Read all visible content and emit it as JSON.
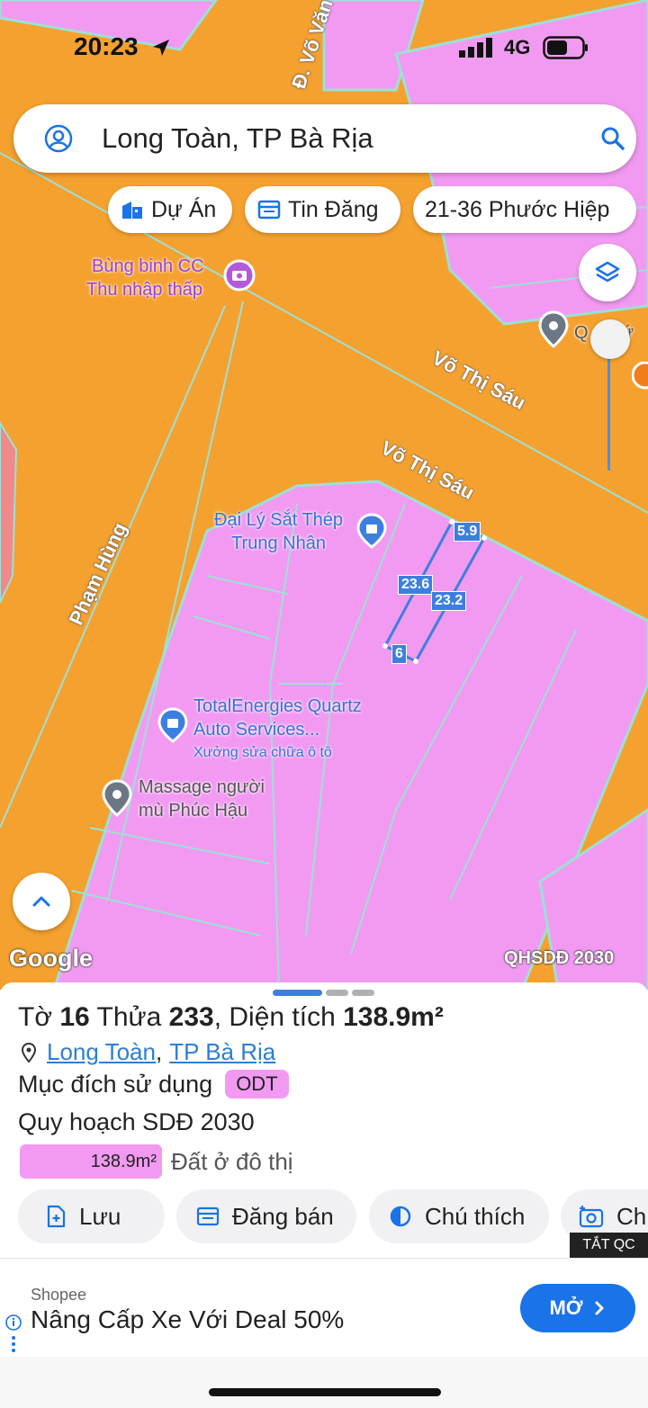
{
  "status_bar": {
    "time": "20:23",
    "network": "4G"
  },
  "search": {
    "query": "Long Toàn, TP Bà Rịa"
  },
  "chips": [
    {
      "label": "Dự Án"
    },
    {
      "label": "Tin Đăng"
    },
    {
      "label": "21-36 Phước Hiệp"
    }
  ],
  "map": {
    "pois": [
      {
        "line1": "Bùng binh CC",
        "line2": "Thu nhập thấp"
      },
      {
        "line1": "Đại Lý Sắt Thép",
        "line2": "Trung Nhân"
      },
      {
        "line1": "TotalEnergies Quartz",
        "line2": "Auto Services...",
        "sub": "Xưởng sửa chữa ô tô"
      },
      {
        "line1": "Massage người",
        "line2": "mù Phúc Hậu"
      },
      {
        "line1": "Q",
        "line2": "bứ"
      }
    ],
    "streets": [
      "Đ. Võ Văn",
      "Võ Thị Sáu",
      "Võ Thị Sáu",
      "Phạm Hùng"
    ],
    "dimensions": [
      "5.9",
      "23.6",
      "23.2",
      "6"
    ],
    "google_logo": "Google",
    "layer_label": "QHSDĐ 2030",
    "colors": {
      "road": "#f5a12f",
      "residential": "#f29af2",
      "outline": "#9de0d6",
      "selection": "#3d7fe0"
    }
  },
  "sheet": {
    "parcel": {
      "prefix": "Tờ",
      "sheet_no": "16",
      "plot_label": "Thửa",
      "plot_no": "233",
      "area_label": ", Diện tích",
      "area": "138.9m²"
    },
    "location": {
      "ward": "Long Toàn",
      "separator": ",",
      "city": "TP Bà Rịa"
    },
    "purpose_label": "Mục đích sử dụng",
    "purpose_code": "ODT",
    "planning_label": "Quy hoạch SDĐ 2030",
    "planning_area": "138.9m²",
    "planning_type": "Đất ở đô thị",
    "actions": [
      "Lưu",
      "Đăng bán",
      "Chú thích",
      "Ch"
    ]
  },
  "ad": {
    "close_label": "TẮT QC",
    "source": "Shopee",
    "title": "Nâng Cấp Xe Với Deal 50%",
    "cta": "MỞ"
  }
}
